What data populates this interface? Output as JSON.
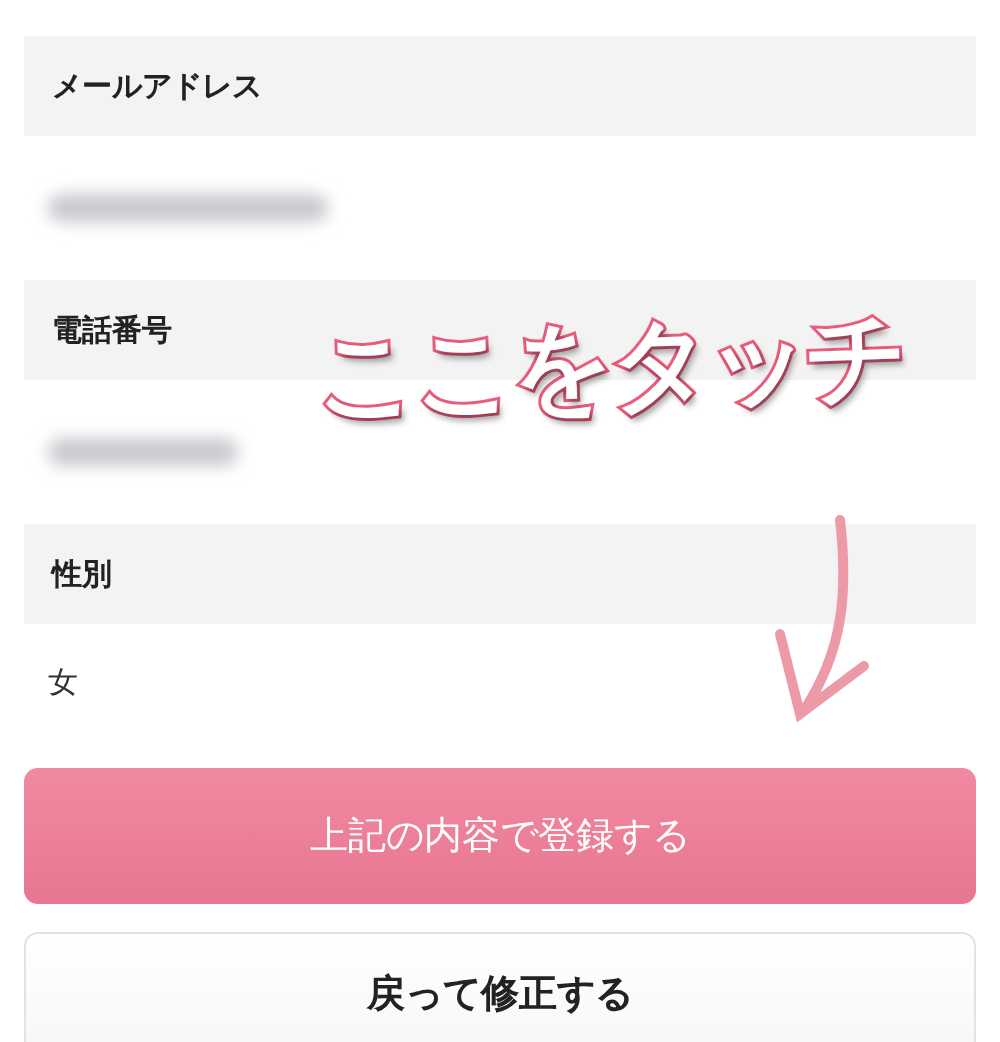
{
  "fields": [
    {
      "label": "メールアドレス",
      "kind": "blurred"
    },
    {
      "label": "電話番号",
      "kind": "blurred"
    },
    {
      "label": "性別",
      "kind": "text",
      "value": "女"
    }
  ],
  "buttons": [
    {
      "label": "上記の内容で登録する",
      "kind": "primary"
    },
    {
      "label": "戻って修正する",
      "kind": "secondary"
    }
  ],
  "annotation": {
    "text": "ここをタッチ"
  }
}
